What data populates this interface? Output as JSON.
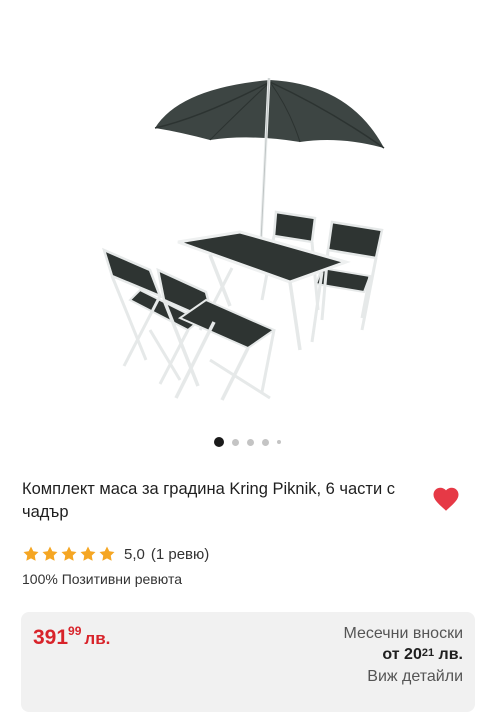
{
  "product": {
    "title": "Комплект маса за градина Kring Piknik, 6 части с чадър",
    "image_icon": "garden-furniture-photo",
    "rating": {
      "value": "5,0",
      "count_text": "(1 ревю)",
      "stars": 5,
      "star_color": "#f5a623"
    },
    "positive_reviews": "100% Позитивни ревюта",
    "favorite_color": "#e63946"
  },
  "carousel": {
    "total_dots": 5,
    "active_index": 0
  },
  "price": {
    "whole": "391",
    "cents": "99",
    "currency": "лв.",
    "color": "#d8232a"
  },
  "installments": {
    "label": "Месечни вноски",
    "prefix": "от",
    "whole": "20",
    "cents": "21",
    "currency": "лв.",
    "link": "Виж детайли"
  }
}
